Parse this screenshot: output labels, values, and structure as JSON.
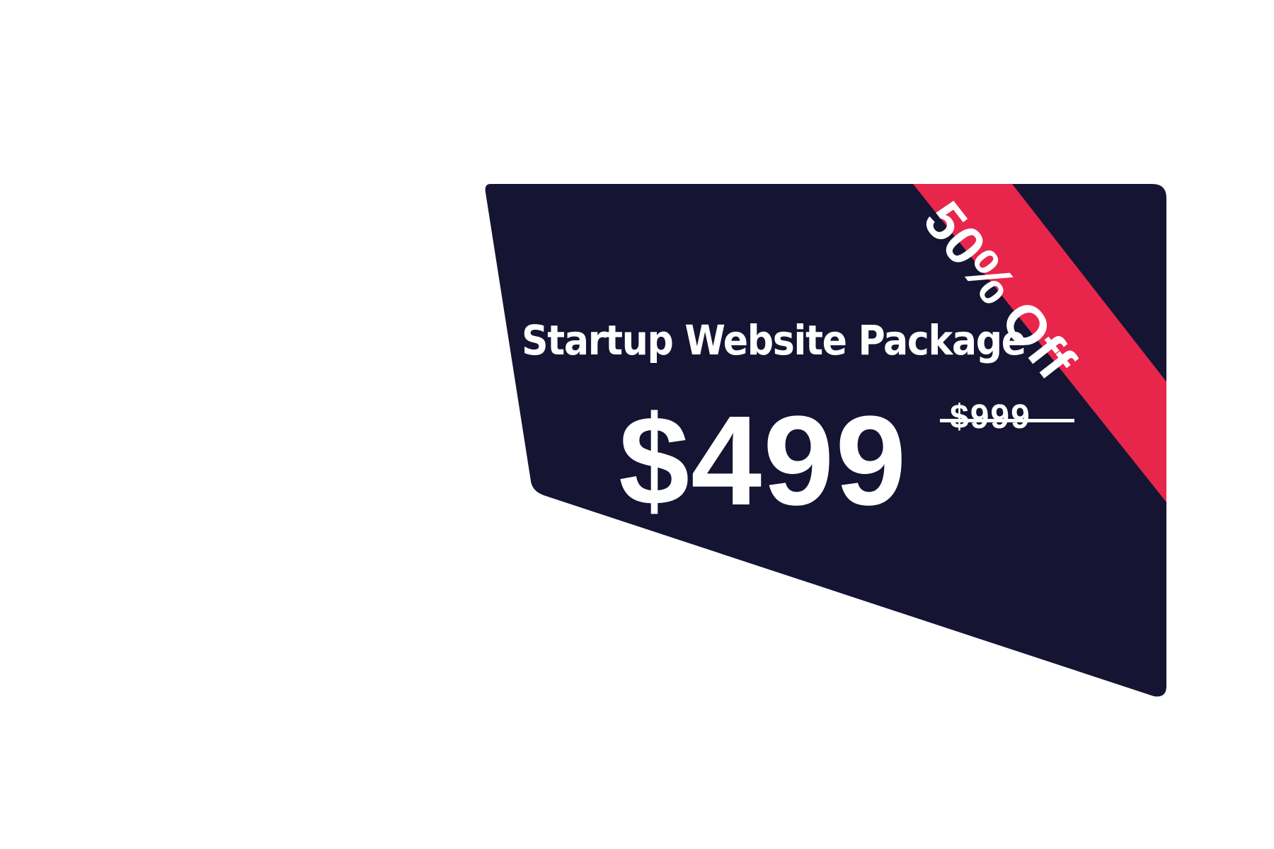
{
  "package": {
    "title": "Startup Website Package",
    "price": "$499",
    "original_price": "$999",
    "discount_label": "50% Off"
  },
  "colors": {
    "card_background": "#151433",
    "ribbon": "#E8264B",
    "text": "#FFFFFF",
    "page_background": "#FFFFFF"
  }
}
